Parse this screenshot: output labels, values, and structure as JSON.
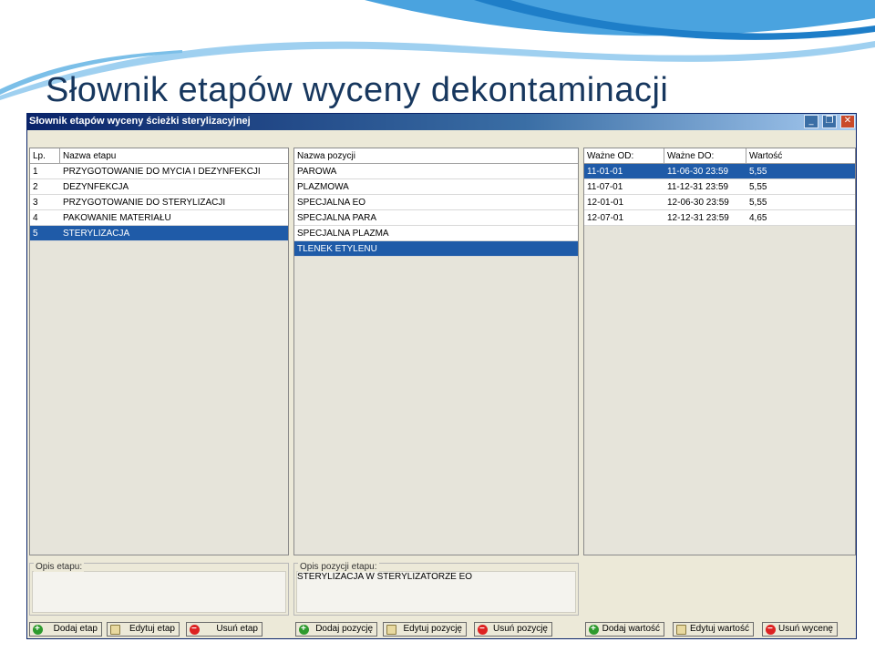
{
  "slide": {
    "title": "Słownik etapów wyceny dekontaminacji"
  },
  "window": {
    "title": "Słownik etapów wyceny ścieżki sterylizacyjnej",
    "controls": {
      "minimize": "_",
      "restore": "❐",
      "close": "✕"
    }
  },
  "stages": {
    "columns": [
      "Lp.",
      "Nazwa etapu"
    ],
    "rows": [
      {
        "lp": "1",
        "name": "PRZYGOTOWANIE DO MYCIA I DEZYNFEKCJI",
        "selected": false
      },
      {
        "lp": "2",
        "name": "DEZYNFEKCJA",
        "selected": false
      },
      {
        "lp": "3",
        "name": "PRZYGOTOWANIE DO STERYLIZACJI",
        "selected": false
      },
      {
        "lp": "4",
        "name": "PAKOWANIE MATERIAŁU",
        "selected": false
      },
      {
        "lp": "5",
        "name": "STERYLIZACJA",
        "selected": true
      }
    ],
    "description_label": "Opis etapu:",
    "description_value": "",
    "buttons": {
      "add": "Dodaj etap",
      "edit": "Edytuj etap",
      "delete": "Usuń etap"
    }
  },
  "positions": {
    "columns": [
      "Nazwa pozycji"
    ],
    "rows": [
      {
        "name": "PAROWA",
        "selected": false
      },
      {
        "name": "PLAZMOWA",
        "selected": false
      },
      {
        "name": "SPECJALNA EO",
        "selected": false
      },
      {
        "name": "SPECJALNA PARA",
        "selected": false
      },
      {
        "name": "SPECJALNA PLAZMA",
        "selected": false
      },
      {
        "name": "TLENEK ETYLENU",
        "selected": true
      }
    ],
    "description_label": "Opis pozycji etapu:",
    "description_value": "STERYLIZACJA W STERYLIZATORZE EO",
    "buttons": {
      "add": "Dodaj pozycję",
      "edit": "Edytuj pozycję",
      "delete": "Usuń pozycję"
    }
  },
  "values": {
    "columns": [
      "Ważne OD:",
      "Ważne DO:",
      "Wartość"
    ],
    "rows": [
      {
        "from": "11-01-01",
        "to": "11-06-30 23:59",
        "value": "5,55",
        "selected": true
      },
      {
        "from": "11-07-01",
        "to": "11-12-31 23:59",
        "value": "5,55",
        "selected": false
      },
      {
        "from": "12-01-01",
        "to": "12-06-30 23:59",
        "value": "5,55",
        "selected": false
      },
      {
        "from": "12-07-01",
        "to": "12-12-31 23:59",
        "value": "4,65",
        "selected": false
      }
    ],
    "buttons": {
      "add": "Dodaj wartość",
      "edit": "Edytuj wartość",
      "delete": "Usuń wycenę"
    }
  },
  "colors": {
    "title": "#17375e",
    "selection": "#1f5ba8",
    "titlebar": "#0a246a",
    "wave": "#4aa3df"
  },
  "icons": {
    "add": "add-icon",
    "edit": "edit-icon",
    "delete": "delete-icon"
  }
}
